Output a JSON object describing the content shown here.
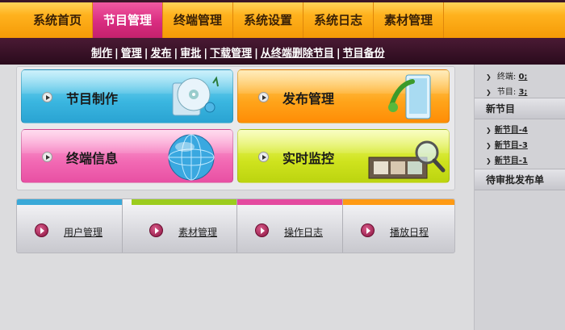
{
  "topnav": {
    "items": [
      {
        "label": "系统首页"
      },
      {
        "label": "节目管理"
      },
      {
        "label": "终端管理"
      },
      {
        "label": "系统设置"
      },
      {
        "label": "系统日志"
      },
      {
        "label": "素材管理"
      }
    ],
    "active_index": 1
  },
  "subnav": {
    "links": [
      "制作",
      "管理",
      "发布",
      "审批",
      "下载管理",
      "从终端删除节目",
      "节目备份"
    ],
    "separator": "|"
  },
  "tiles": [
    {
      "label": "节目制作",
      "icon": "disc-media-icon"
    },
    {
      "label": "发布管理",
      "icon": "publish-phone-icon"
    },
    {
      "label": "终端信息",
      "icon": "globe-icon"
    },
    {
      "label": "实时监控",
      "icon": "film-magnifier-icon"
    }
  ],
  "quick": [
    {
      "label": "用户管理",
      "color": "#3aa9d8"
    },
    {
      "label": "素材管理",
      "color": "#9ccc1e"
    },
    {
      "label": "操作日志",
      "color": "#e44a9f"
    },
    {
      "label": "播放日程",
      "color": "#ff9a14"
    }
  ],
  "side": {
    "terminal_label": "终端:",
    "terminal_count": "0;",
    "program_label": "节目:",
    "program_count": "3;",
    "new_programs_title": "新节目",
    "new_programs": [
      "新节目-4",
      "新节目-3",
      "新节目-1"
    ],
    "pending_title": "待审批发布单"
  }
}
